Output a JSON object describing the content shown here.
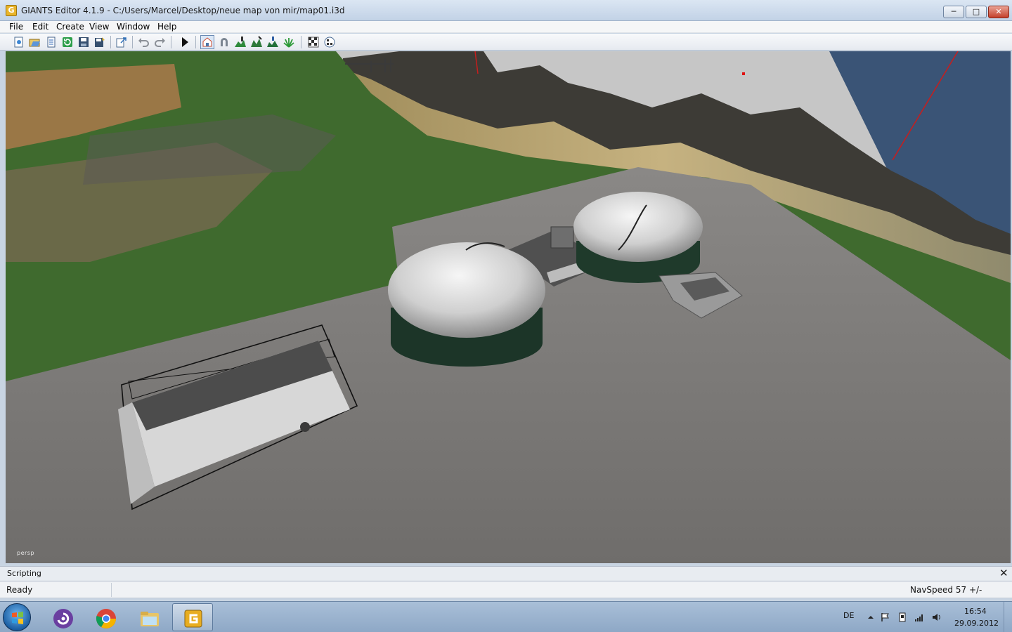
{
  "window": {
    "app_icon_letter": "G",
    "title": "GIANTS Editor 4.1.9 - C:/Users/Marcel/Desktop/neue map von mir/map01.i3d",
    "minimize_glyph": "─",
    "maximize_glyph": "□",
    "close_glyph": "✕"
  },
  "menu": {
    "items": [
      {
        "label": "File"
      },
      {
        "label": "Edit"
      },
      {
        "label": "Create"
      },
      {
        "label": "View"
      },
      {
        "label": "Window"
      },
      {
        "label": "Help"
      }
    ]
  },
  "toolbar": {
    "buttons": [
      {
        "icon": "new-icon"
      },
      {
        "icon": "open-icon"
      },
      {
        "icon": "import-icon"
      },
      {
        "icon": "refresh-icon"
      },
      {
        "icon": "save-icon"
      },
      {
        "icon": "save-as-icon"
      },
      {
        "icon": "export-icon"
      },
      {
        "icon": "undo-icon"
      },
      {
        "icon": "redo-icon"
      },
      {
        "icon": "play-icon"
      },
      {
        "icon": "select-mode-icon",
        "active": true
      },
      {
        "icon": "magnet-icon"
      },
      {
        "icon": "terrain-paint-icon"
      },
      {
        "icon": "terrain-sculpt-icon"
      },
      {
        "icon": "terrain-smooth-icon"
      },
      {
        "icon": "foliage-paint-icon"
      },
      {
        "icon": "texture-paint-icon"
      },
      {
        "icon": "texture-erase-icon"
      }
    ]
  },
  "viewport": {
    "camera_label": "persp",
    "sky_color": "#c6c6c6",
    "water_color": "#3a5476",
    "grass_color": "#3f6a2e",
    "ground_color": "#7d7b78",
    "dome_color": "#e2e2e2",
    "tank_color": "#1f3a2b"
  },
  "scripting": {
    "title": "Scripting",
    "close_glyph": "✕"
  },
  "status": {
    "left": "Ready",
    "right": "NavSpeed 57 +/-"
  },
  "taskbar": {
    "apps": [
      {
        "name": "bittorrent",
        "state": "pinned"
      },
      {
        "name": "chrome",
        "state": "pinned"
      },
      {
        "name": "explorer",
        "state": "pinned"
      },
      {
        "name": "giants-editor",
        "state": "open"
      }
    ],
    "tray": {
      "language": "DE",
      "time": "16:54",
      "date": "29.09.2012"
    }
  }
}
